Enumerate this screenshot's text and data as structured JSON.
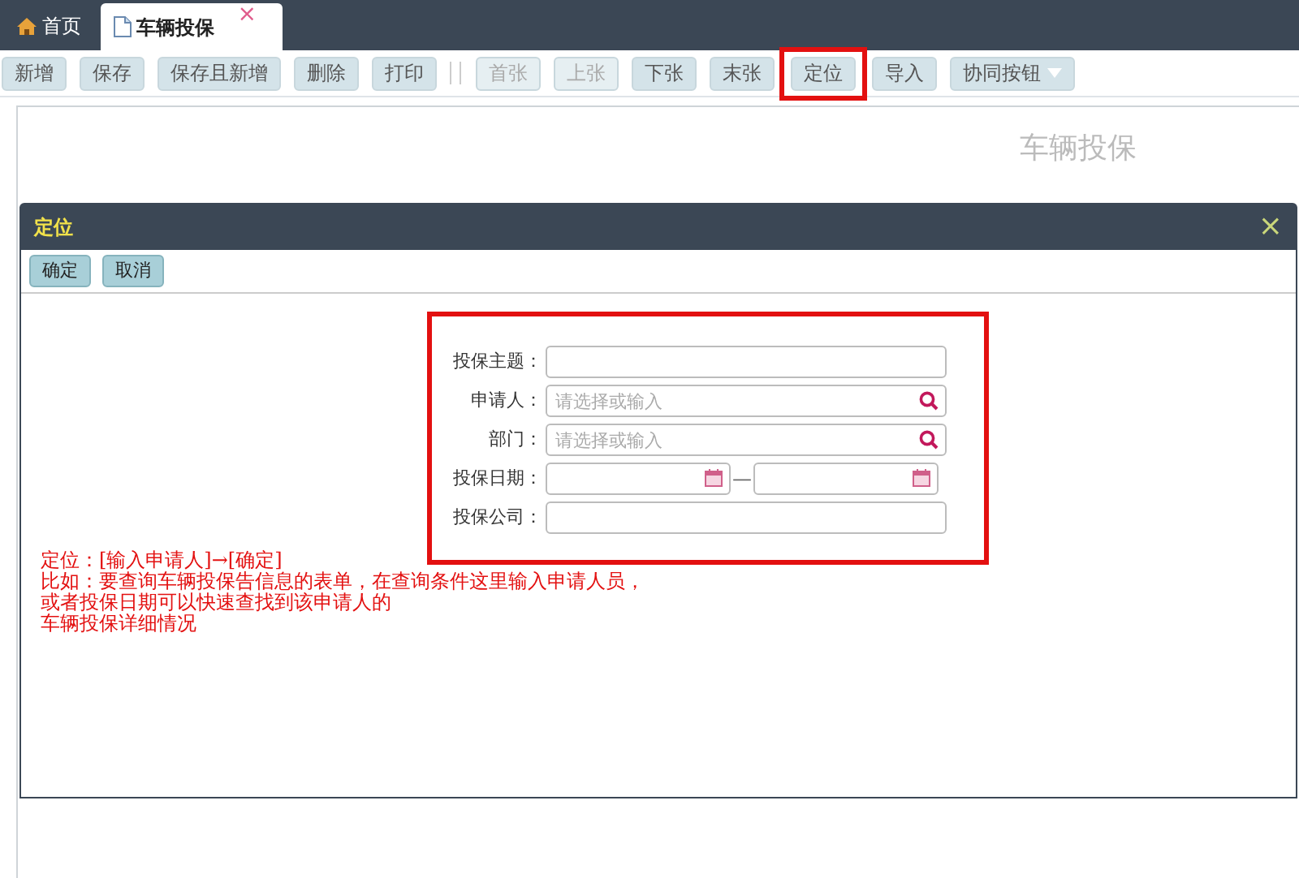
{
  "tabs": [
    {
      "label": "首页",
      "selected": false
    },
    {
      "label": "车辆投保",
      "selected": true,
      "close_glyph": "×"
    }
  ],
  "toolbar": [
    {
      "kind": "button",
      "label": "新增",
      "disabled": false,
      "highlighted": false
    },
    {
      "kind": "button",
      "label": "保存",
      "disabled": false,
      "highlighted": false
    },
    {
      "kind": "button",
      "label": "保存且新增",
      "disabled": false,
      "highlighted": false
    },
    {
      "kind": "button",
      "label": "删除",
      "disabled": false,
      "highlighted": false
    },
    {
      "kind": "button",
      "label": "打印",
      "disabled": false,
      "highlighted": false
    },
    {
      "kind": "separator"
    },
    {
      "kind": "button",
      "label": "首张",
      "disabled": true,
      "highlighted": false
    },
    {
      "kind": "button",
      "label": "上张",
      "disabled": true,
      "highlighted": false
    },
    {
      "kind": "button",
      "label": "下张",
      "disabled": false,
      "highlighted": false
    },
    {
      "kind": "button",
      "label": "末张",
      "disabled": false,
      "highlighted": false
    },
    {
      "kind": "button",
      "label": "定位",
      "disabled": false,
      "highlighted": true
    },
    {
      "kind": "button",
      "label": "导入",
      "disabled": false,
      "highlighted": false
    },
    {
      "kind": "dropdown",
      "label": "协同按钮",
      "disabled": false,
      "highlighted": false
    }
  ],
  "page_title": "车辆投保",
  "dialog": {
    "title": "定位",
    "close_glyph": "×",
    "buttons": [
      "确定",
      "取消"
    ],
    "form_highlighted": true,
    "fields": [
      {
        "label": "投保主题：",
        "kind": "text"
      },
      {
        "label": "申请人：",
        "kind": "lookup",
        "placeholder": "请选择或输入"
      },
      {
        "label": "部门：",
        "kind": "lookup",
        "placeholder": "请选择或输入"
      },
      {
        "label": "投保日期：",
        "kind": "daterange",
        "separator": "—"
      },
      {
        "label": "投保公司：",
        "kind": "text"
      }
    ],
    "annotation": [
      "定位：[输入申请人]→[确定]",
      "比如：要查询车辆投保告信息的表单，在查询条件这里输入申请人员，",
      "或者投保日期可以快速查找到该申请人的",
      "车辆投保详细情况"
    ]
  }
}
